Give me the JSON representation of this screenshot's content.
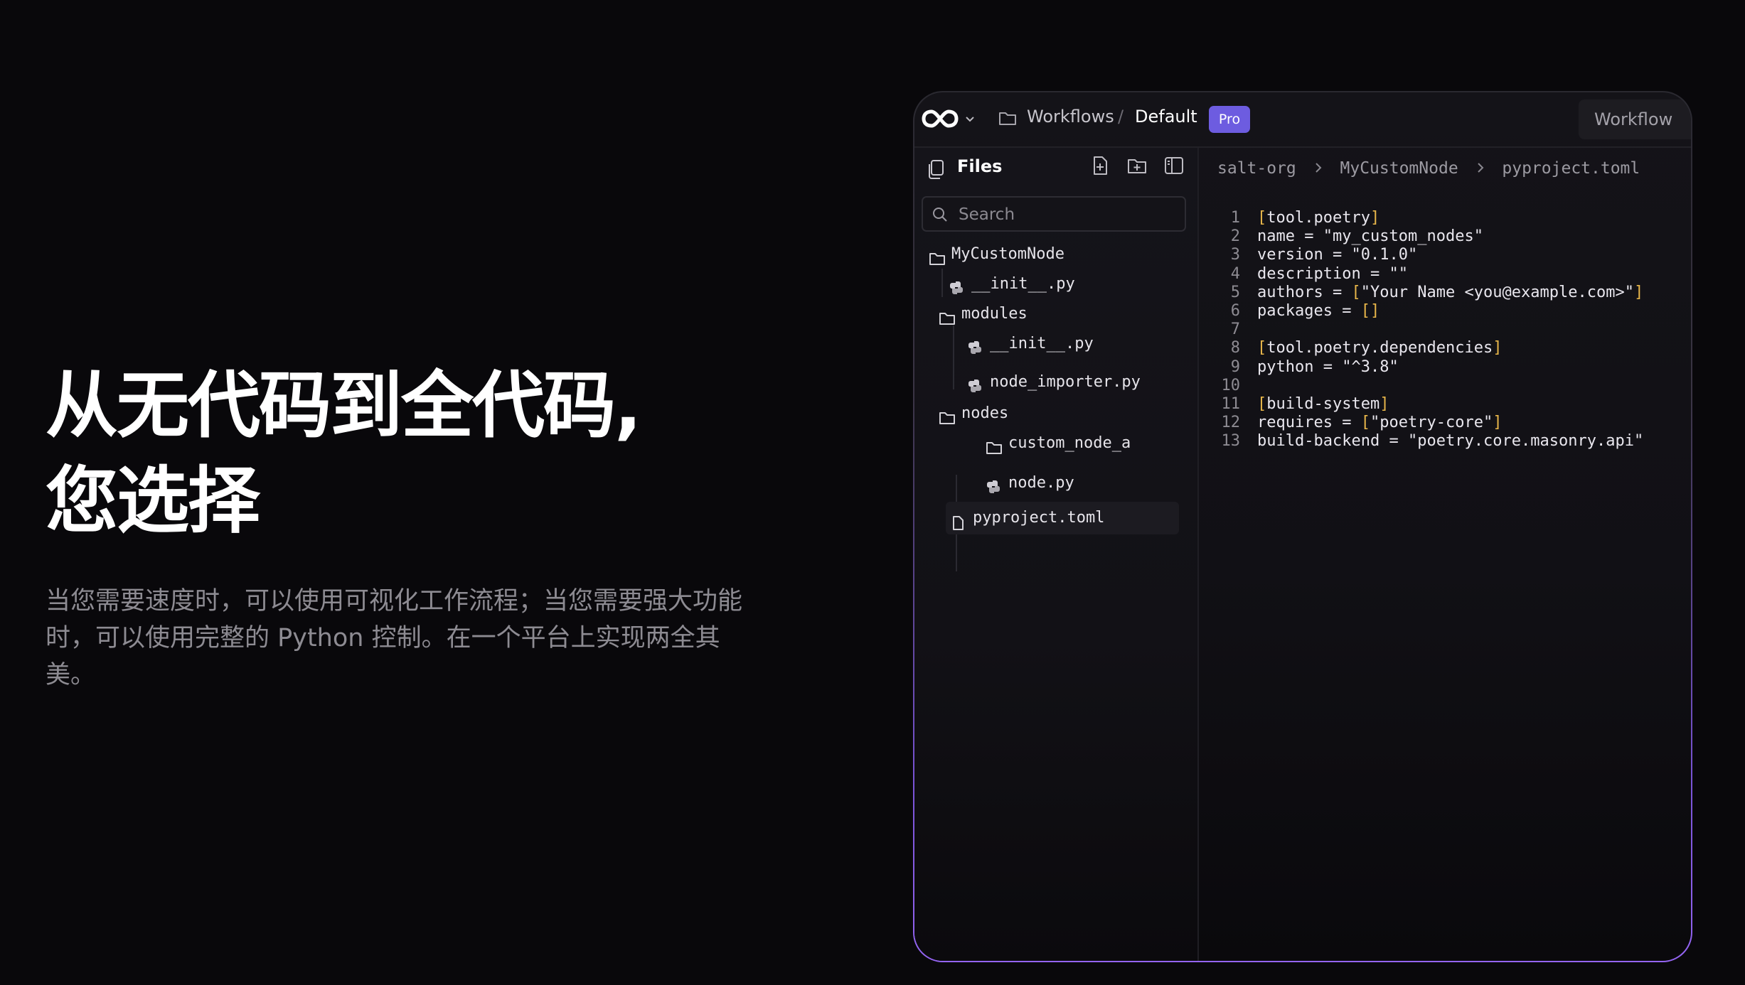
{
  "hero": {
    "title_line1": "从无代码到全代码,",
    "title_line2": "您选择",
    "description": "当您需要速度时，可以使用可视化工作流程；当您需要强大功能时，可以使用完整的 Python 控制。在一个平台上实现两全其美。"
  },
  "topbar": {
    "logo_icon": "infinity-logo-icon",
    "breadcrumb_workflows": "Workflows",
    "breadcrumb_separator": "/",
    "breadcrumb_default": "Default",
    "badge": "Pro",
    "workflow_button": "Workflow",
    "accent_color": "#6d5ce0"
  },
  "sidebar": {
    "title": "Files",
    "search_placeholder": "Search",
    "tree": [
      {
        "label": "MyCustomNode",
        "type": "folder"
      },
      {
        "label": "__init__.py",
        "type": "python"
      },
      {
        "label": "modules",
        "type": "folder"
      },
      {
        "label": "__init__.py",
        "type": "python"
      },
      {
        "label": "node_importer.py",
        "type": "python"
      },
      {
        "label": "nodes",
        "type": "folder"
      },
      {
        "label": "custom_node_a",
        "type": "folder"
      },
      {
        "label": "node.py",
        "type": "python"
      },
      {
        "label": "pyproject.toml",
        "type": "file",
        "selected": true
      }
    ]
  },
  "editor": {
    "path": [
      "salt-org",
      "MyCustomNode",
      "pyproject.toml"
    ],
    "lines": [
      "[tool.poetry]",
      "name = \"my_custom_nodes\"",
      "version = \"0.1.0\"",
      "description = \"\"",
      "authors = [\"Your Name <you@example.com>\"]",
      "packages = []",
      "",
      "[tool.poetry.dependencies]",
      "python = \"^3.8\"",
      "",
      "[build-system]",
      "requires = [\"poetry-core\"]",
      "build-backend = \"poetry.core.masonry.api\""
    ]
  }
}
